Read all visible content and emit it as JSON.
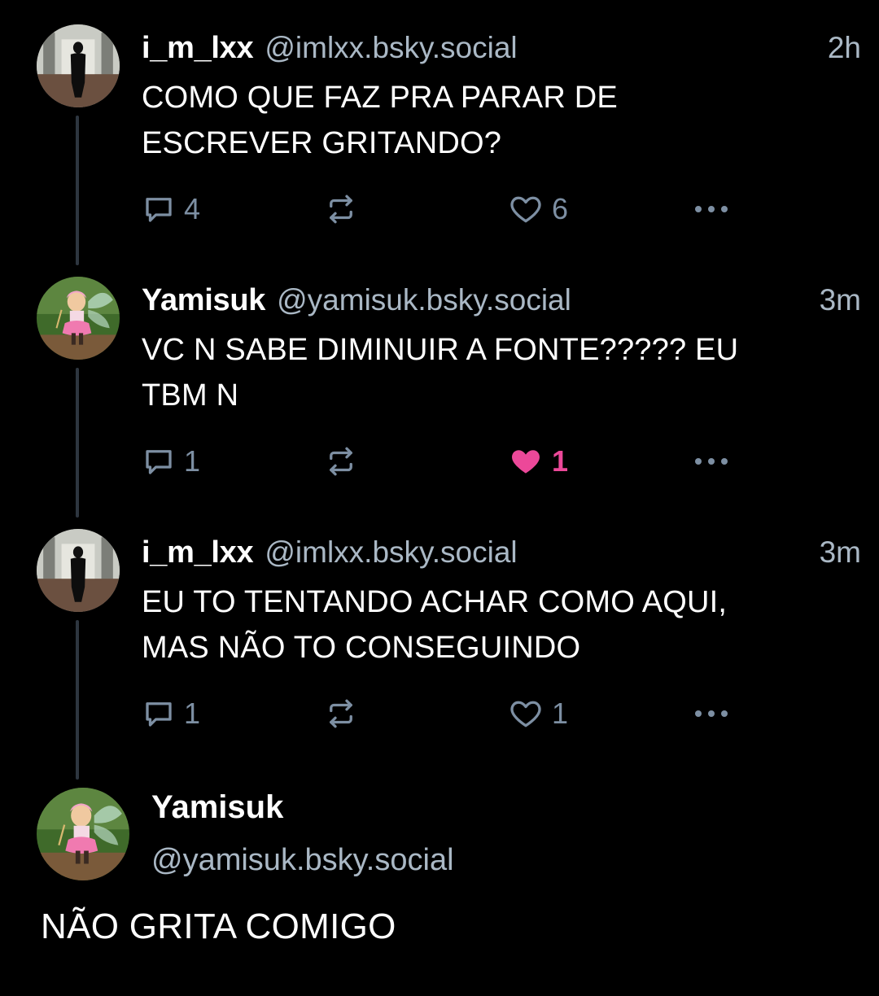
{
  "thread": [
    {
      "author": "i_m_lxx",
      "handle": "@imlxx.bsky.social",
      "time": "2h",
      "text_lines": [
        "COMO QUE FAZ PRA PARAR DE",
        "ESCREVER GRITANDO?"
      ],
      "reply_count": "4",
      "like_count": "6",
      "liked": false,
      "avatar_icon": "person-in-hallway-avatar"
    },
    {
      "author": "Yamisuk",
      "handle": "@yamisuk.bsky.social",
      "time": "3m",
      "text_lines": [
        "VC N SABE DIMINUIR A FONTE????? EU",
        "TBM N"
      ],
      "reply_count": "1",
      "like_count": "1",
      "liked": true,
      "avatar_icon": "pink-fairy-character-avatar"
    },
    {
      "author": "i_m_lxx",
      "handle": "@imlxx.bsky.social",
      "time": "3m",
      "text_lines": [
        "EU TO TENTANDO ACHAR COMO AQUI,",
        "MAS NÃO TO CONSEGUINDO"
      ],
      "reply_count": "1",
      "like_count": "1",
      "liked": false,
      "avatar_icon": "person-in-hallway-avatar"
    }
  ],
  "focused_post": {
    "author": "Yamisuk",
    "handle": "@yamisuk.bsky.social",
    "text": "NÃO GRITA COMIGO",
    "avatar_icon": "pink-fairy-character-avatar"
  },
  "colors": {
    "background": "#000000",
    "text": "#ffffff",
    "secondary_text": "#aab8c5",
    "action_icon": "#7d8fa3",
    "like_active": "#ec4899",
    "thread_line": "#2e3640"
  }
}
